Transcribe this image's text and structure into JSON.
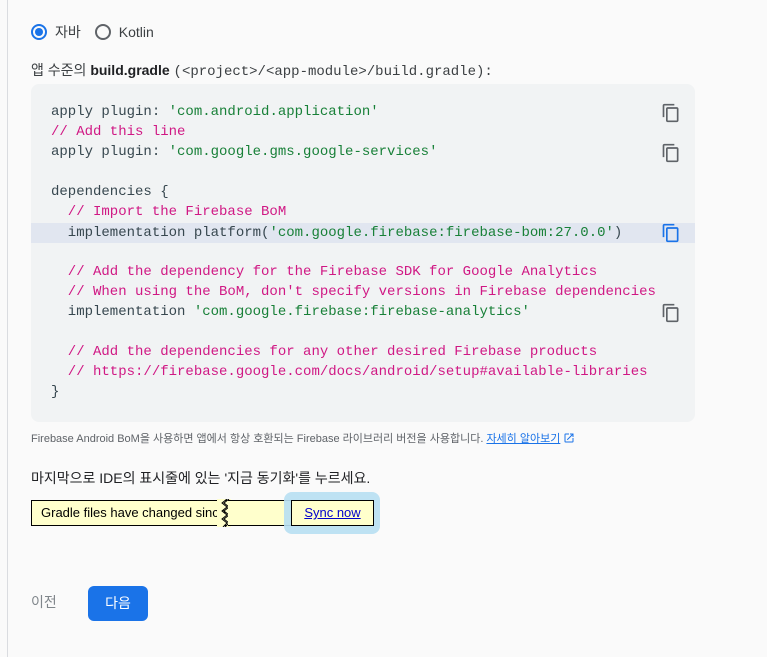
{
  "radios": {
    "java_label": "자바",
    "kotlin_label": "Kotlin",
    "selected": "자바"
  },
  "file_path": {
    "prefix": "앱 수준의 ",
    "file_name": "build.gradle",
    "path": "(<project>/<app-module>/build.gradle):"
  },
  "code": {
    "l1_plain": "apply plugin: ",
    "l1_str": "'com.android.application'",
    "l2_comment": "// Add this line",
    "l3_plain": "apply plugin: ",
    "l3_str": "'com.google.gms.google-services'",
    "l5": "dependencies {",
    "l6_comment": "  // Import the Firebase BoM",
    "l7_plain": "  implementation platform(",
    "l7_str": "'com.google.firebase:firebase-bom:27.0.0'",
    "l7_close": ")",
    "l9_comment": "  // Add the dependency for the Firebase SDK for Google Analytics",
    "l10_comment": "  // When using the BoM, don't specify versions in Firebase dependencies",
    "l11_plain": "  implementation ",
    "l11_str": "'com.google.firebase:firebase-analytics'",
    "l13_comment": "  // Add the dependencies for any other desired Firebase products",
    "l14_comment": "  // https://firebase.google.com/docs/android/setup#available-libraries",
    "l15": "}"
  },
  "icons": {
    "copy": "copy-icon",
    "external": "external-link-icon"
  },
  "note": {
    "text": "Firebase Android BoM을 사용하면 앱에서 항상 호환되는 Firebase 라이브러리 버전을 사용합니다. ",
    "link": "자세히 알아보기"
  },
  "instruction": "마지막으로 IDE의 표시줄에 있는 '지금 동기화'를 누르세요.",
  "ide_bar": {
    "message": "Gradle files have changed since",
    "sync_label": "Sync now"
  },
  "colors": {
    "accent": "#1a73e8",
    "comment": "#d01884",
    "string": "#188038",
    "ide_bar_bg": "#ffffcc"
  },
  "nav": {
    "prev_label": "이전",
    "next_label": "다음"
  }
}
